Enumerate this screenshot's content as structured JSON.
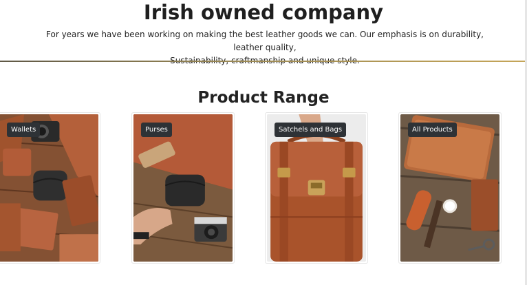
{
  "hero": {
    "title": "Irish owned company",
    "description_line1": "For years we have been working on making the best leather goods we can. Our emphasis is on durability, leather quality,",
    "description_line2": "Sustainability, craftmanship and unique style."
  },
  "product_range": {
    "title": "Product Range",
    "cards": [
      {
        "label": "Wallets"
      },
      {
        "label": "Purses"
      },
      {
        "label": "Satchels and Bags"
      },
      {
        "label": "All Products"
      }
    ]
  },
  "colors": {
    "badge_bg": "#2e3236",
    "accent_gold": "#c5a558",
    "leather_brown": "#a0532d"
  }
}
